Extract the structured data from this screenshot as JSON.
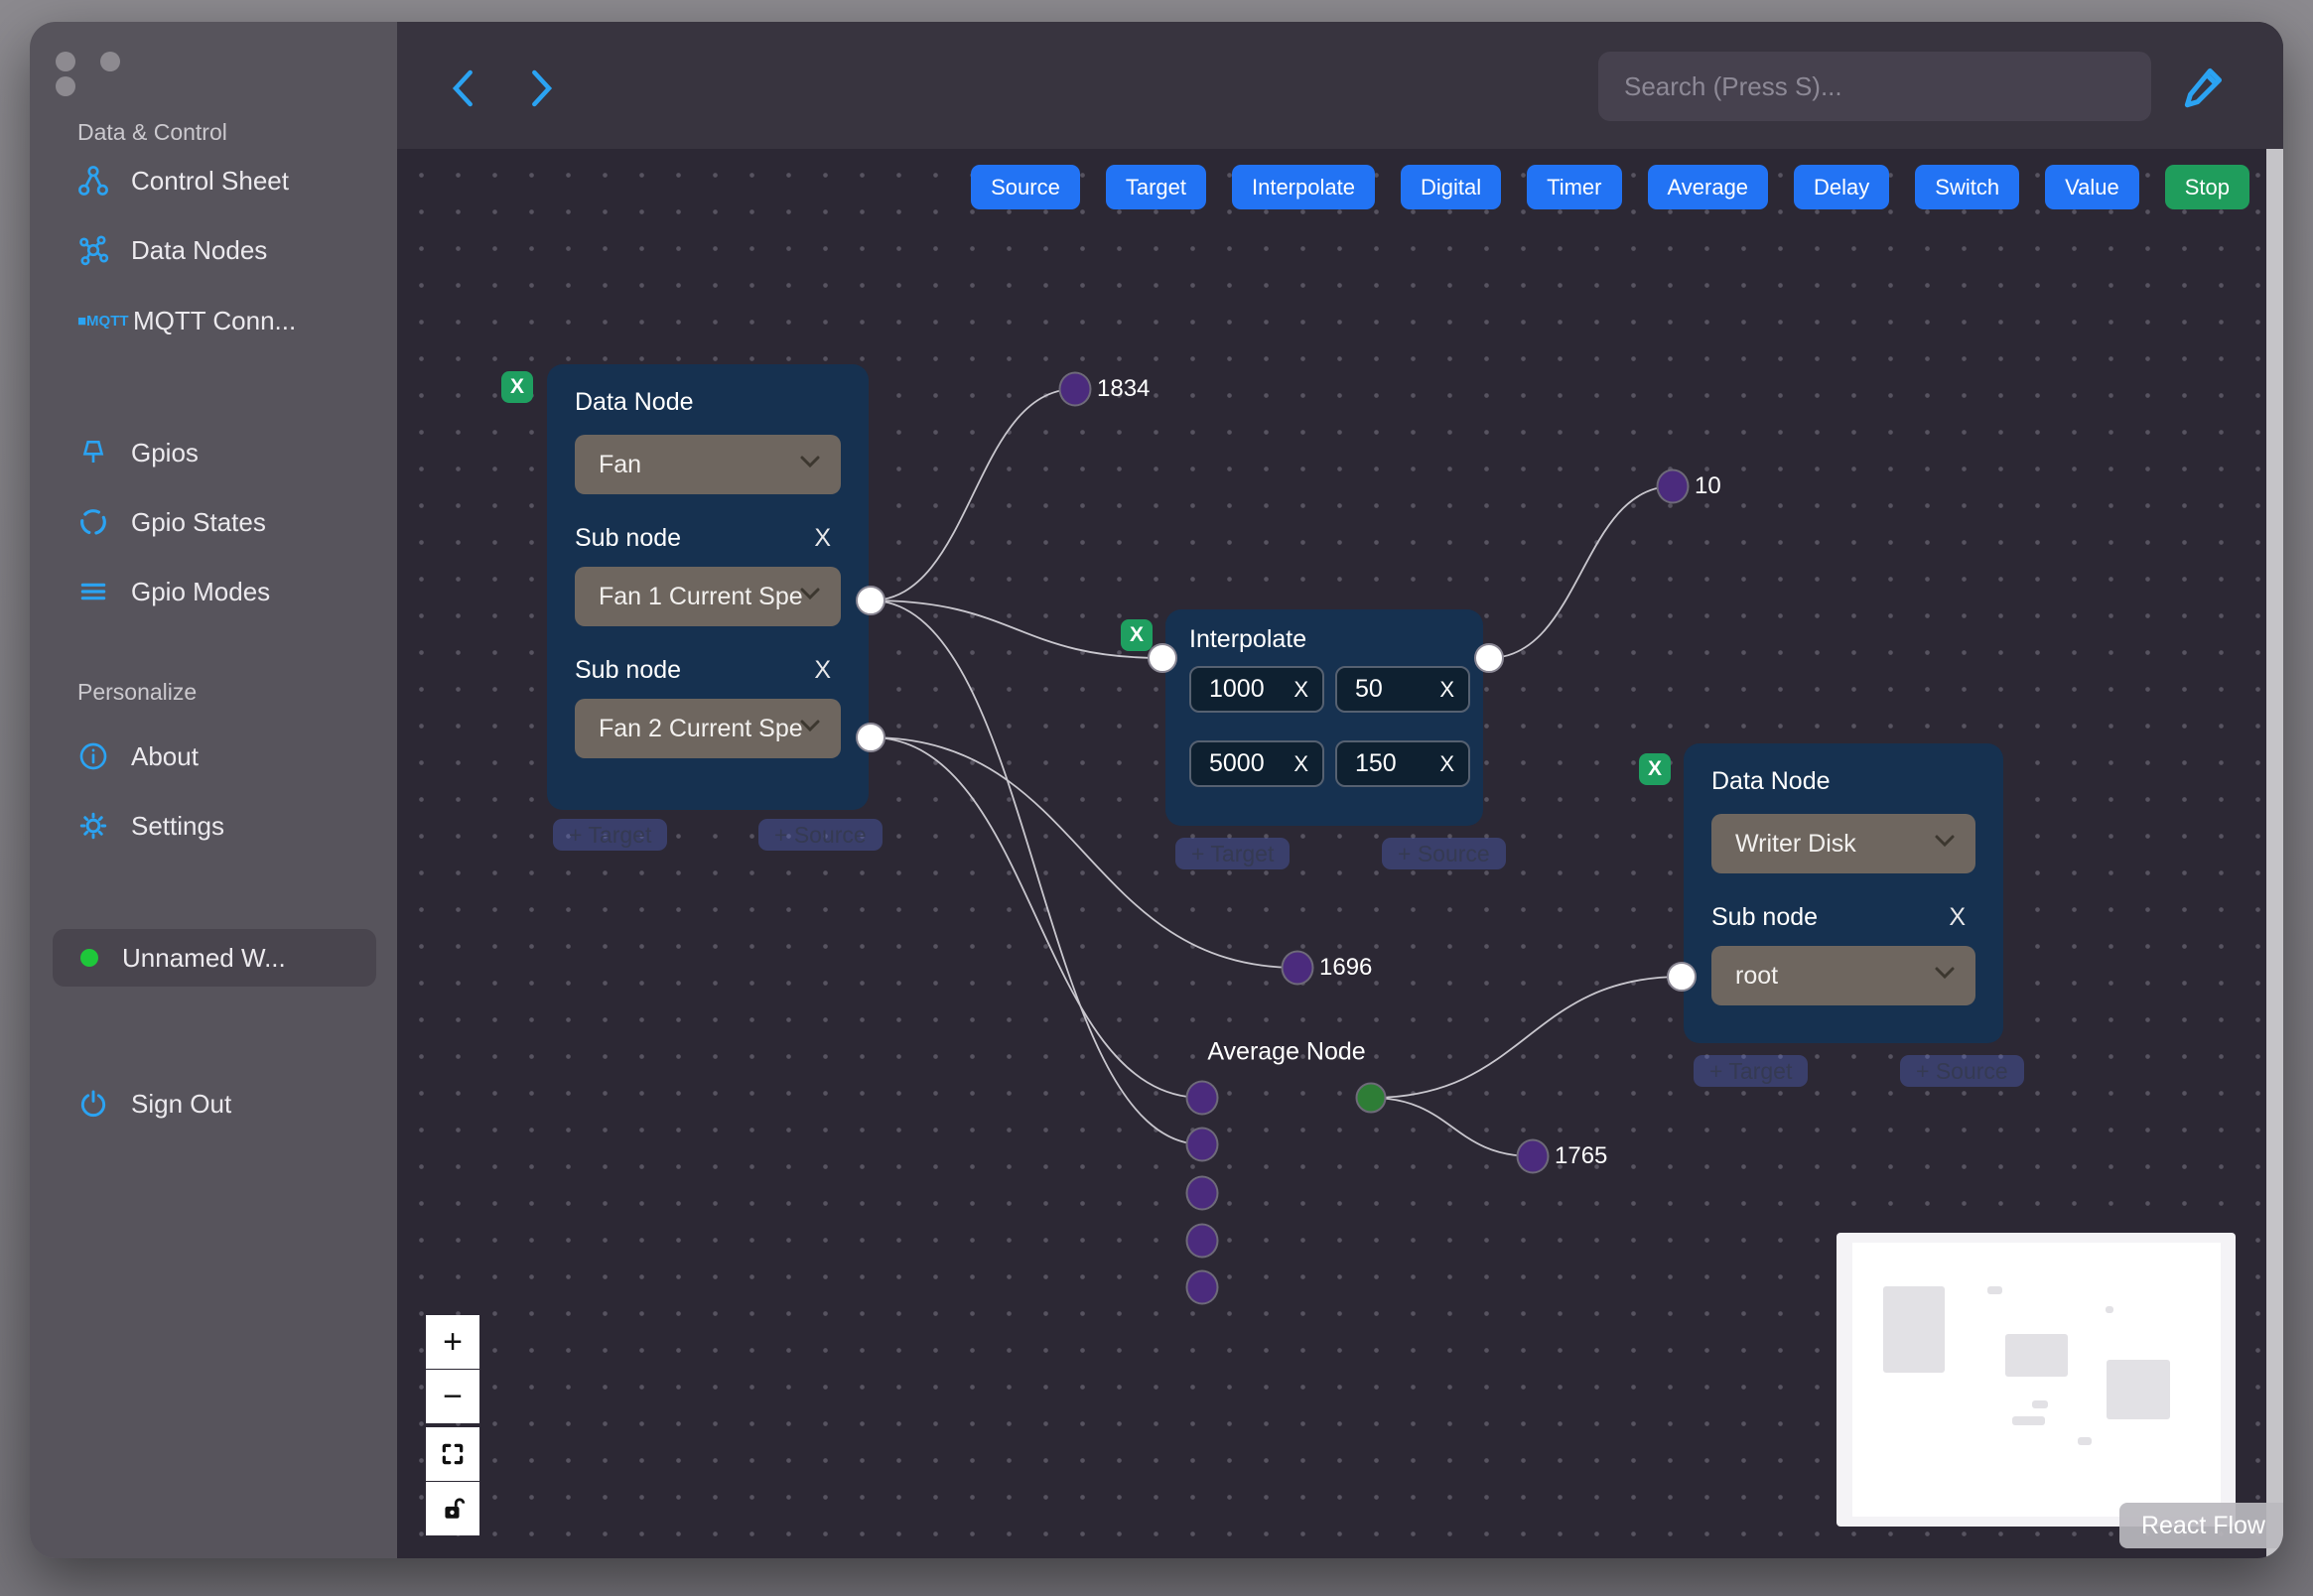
{
  "sidebar": {
    "section_data_control": "Data & Control",
    "items": [
      {
        "label": "Control Sheet"
      },
      {
        "label": "Data Nodes"
      },
      {
        "label": "MQTT Conn..."
      },
      {
        "label": "Gpios"
      },
      {
        "label": "Gpio States"
      },
      {
        "label": "Gpio Modes"
      }
    ],
    "section_personalize": "Personalize",
    "about": "About",
    "settings": "Settings",
    "workspace": "Unnamed W...",
    "sign_out": "Sign Out"
  },
  "topbar": {
    "search_placeholder": "Search (Press S)..."
  },
  "toolbar": {
    "buttons": [
      {
        "label": "Source"
      },
      {
        "label": "Target"
      },
      {
        "label": "Interpolate"
      },
      {
        "label": "Digital"
      },
      {
        "label": "Timer"
      },
      {
        "label": "Average"
      },
      {
        "label": "Delay"
      },
      {
        "label": "Switch"
      },
      {
        "label": "Value"
      },
      {
        "label": "Stop"
      }
    ]
  },
  "nodes": {
    "fan": {
      "title": "Data Node",
      "type_value": "Fan",
      "sub_label": "Sub node",
      "sub1_value": "Fan 1 Current Spe",
      "sub2_value": "Fan 2 Current Spe"
    },
    "interpolate": {
      "title": "Interpolate",
      "in1": "1000",
      "in2": "50",
      "in3": "5000",
      "in4": "150"
    },
    "writer": {
      "title": "Data Node",
      "type_value": "Writer Disk",
      "sub_label": "Sub node",
      "sub_value": "root"
    },
    "average": {
      "title": "Average Node"
    }
  },
  "edge_labels": {
    "e1": "1834",
    "e2": "10",
    "e3": "1696",
    "e4": "1765"
  },
  "labels": {
    "x": "X",
    "add_target": "+ Target",
    "add_source": "+ Source"
  },
  "controls": {
    "zoom_in": "+",
    "zoom_out": "−"
  },
  "attribution": "React Flow",
  "colors": {
    "accent_blue": "#2ba3f2",
    "button_blue": "#2273f4",
    "stop_green": "#1f9d5c",
    "badge_green": "#1f9f60",
    "node_bg": "#163150",
    "select_bg": "#6e665f",
    "canvas_bg": "#2c2834",
    "sidebar_bg": "#57545c",
    "handle_purple": "#4b2b7d",
    "handle_green": "#2e7d36",
    "workspace_status_green": "#1ec73a"
  }
}
